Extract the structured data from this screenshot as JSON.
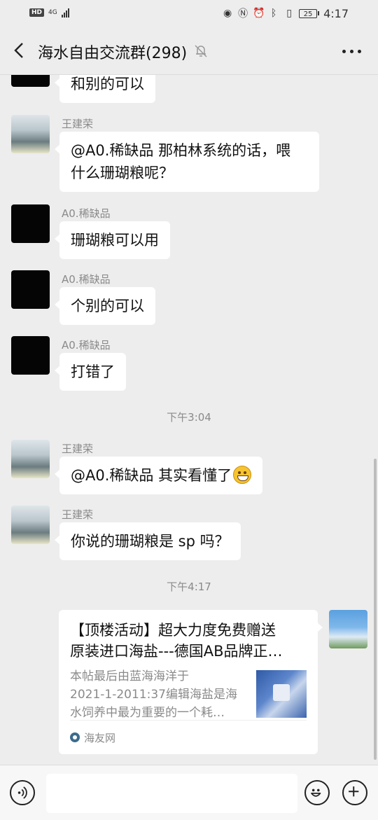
{
  "status_bar": {
    "hd_label": "HD",
    "network_label": "4G",
    "time": "4:17",
    "battery_level": "25"
  },
  "header": {
    "title": "海水自由交流群(298)"
  },
  "messages": [
    {
      "sender": "",
      "text": "和别的可以",
      "avatar": "joker-avatar"
    },
    {
      "sender": "王建荣",
      "text_line1": "@A0.稀缺品  那柏林系统的话，喂",
      "text_line2": "什么珊瑚粮呢？",
      "avatar": "street-avatar"
    },
    {
      "sender": "A0.稀缺品",
      "text": "珊瑚粮可以用",
      "avatar": "joker-avatar"
    },
    {
      "sender": "A0.稀缺品",
      "text": "个别的可以",
      "avatar": "joker-avatar"
    },
    {
      "sender": "A0.稀缺品",
      "text": "打错了",
      "avatar": "joker-avatar"
    },
    {
      "sender": "王建荣",
      "text": "@A0.稀缺品  其实看懂了",
      "avatar": "street-avatar",
      "emoji": "grin-emoji"
    },
    {
      "sender": "王建荣",
      "text": "你说的珊瑚粮是 sp 吗？",
      "avatar": "street-avatar"
    }
  ],
  "timestamps": [
    "下午3:04",
    "下午4:17"
  ],
  "link_card": {
    "title_line1": "【顶楼活动】超大力度免费赠送",
    "title_line2": "原装进口海盐---德国AB品牌正…",
    "desc_line1": "本帖最后由蓝海海洋于",
    "desc_line2": "2021-1-2011:37编辑海盐是海",
    "desc_line3": "水饲养中最为重要的一个耗…",
    "source": "海友网"
  },
  "input_bar": {
    "text_value": ""
  }
}
